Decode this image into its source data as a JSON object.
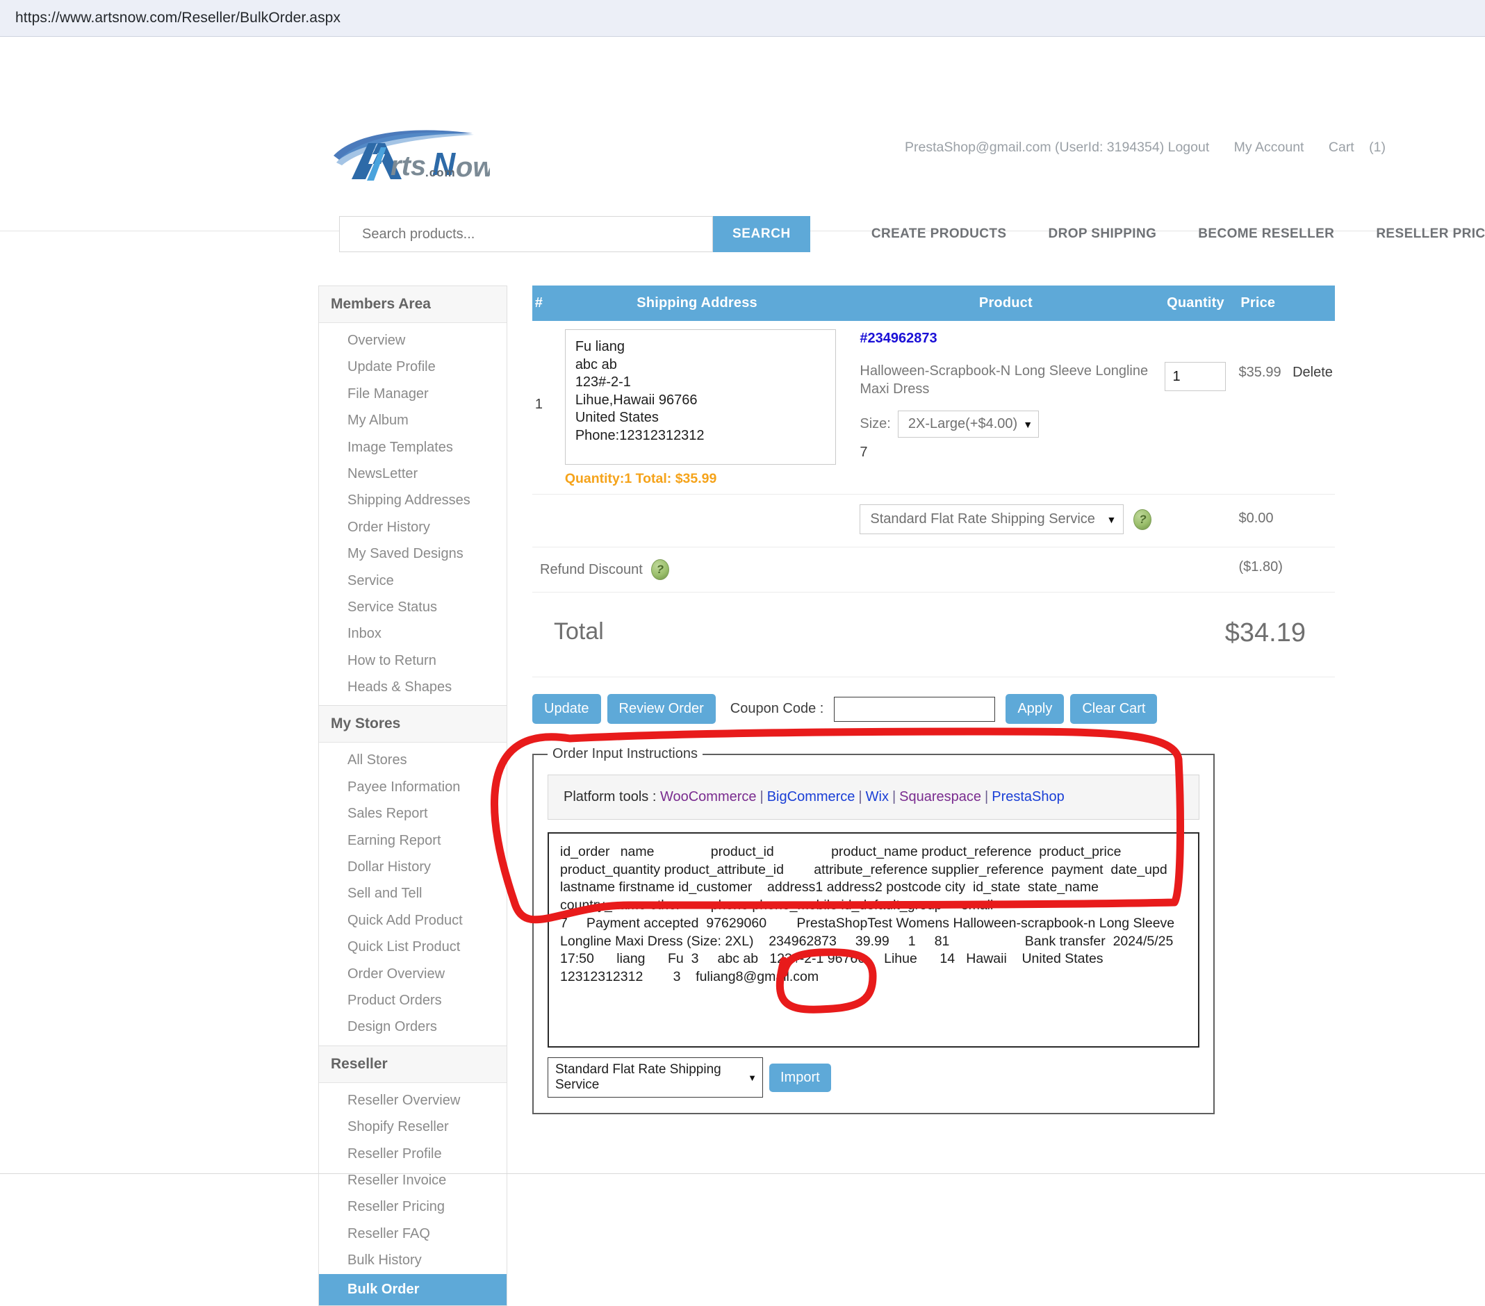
{
  "browser": {
    "url": "https://www.artsnow.com/Reseller/BulkOrder.aspx"
  },
  "header": {
    "logo_text": "ArtsNow",
    "logo_sub": ".com",
    "account_email": "PrestaShop@gmail.com (UserId: 3194354) Logout",
    "my_account": "My Account",
    "cart": "Cart",
    "cart_count": "(1)",
    "search_placeholder": "Search products...",
    "search_value": "",
    "search_button": "SEARCH",
    "nav": [
      {
        "label": "CREATE PRODUCTS"
      },
      {
        "label": "DROP SHIPPING"
      },
      {
        "label": "BECOME RESELLER"
      },
      {
        "label": "RESELLER PRICING"
      }
    ]
  },
  "sidebar": {
    "groups": [
      {
        "title": "Members Area",
        "items": [
          {
            "label": "Overview"
          },
          {
            "label": "Update Profile"
          },
          {
            "label": "File Manager"
          },
          {
            "label": "My Album"
          },
          {
            "label": "Image Templates"
          },
          {
            "label": "NewsLetter"
          },
          {
            "label": "Shipping Addresses"
          },
          {
            "label": "Order History"
          },
          {
            "label": "My Saved Designs"
          },
          {
            "label": "Service"
          },
          {
            "label": "Service Status"
          },
          {
            "label": "Inbox"
          },
          {
            "label": "How to Return"
          },
          {
            "label": "Heads & Shapes"
          }
        ]
      },
      {
        "title": "My Stores",
        "items": [
          {
            "label": "All Stores"
          },
          {
            "label": "Payee Information"
          },
          {
            "label": "Sales Report"
          },
          {
            "label": "Earning Report"
          },
          {
            "label": "Dollar History"
          },
          {
            "label": "Sell and Tell"
          },
          {
            "label": "Quick Add Product"
          },
          {
            "label": "Quick List Product"
          },
          {
            "label": "Order Overview"
          },
          {
            "label": "Product Orders"
          },
          {
            "label": "Design Orders"
          }
        ]
      },
      {
        "title": "Reseller",
        "items": [
          {
            "label": "Reseller Overview"
          },
          {
            "label": "Shopify Reseller"
          },
          {
            "label": "Reseller Profile"
          },
          {
            "label": "Reseller Invoice"
          },
          {
            "label": "Reseller Pricing"
          },
          {
            "label": "Reseller FAQ"
          },
          {
            "label": "Bulk History"
          },
          {
            "label": "Bulk Order",
            "active": true
          }
        ]
      }
    ]
  },
  "order_table": {
    "columns": {
      "num": "#",
      "shipping_address": "Shipping Address",
      "product": "Product",
      "quantity": "Quantity",
      "price": "Price"
    },
    "row": {
      "num": "1",
      "address_text": "Fu liang\nabc ab\n123#-2-1\nLihue,Hawaii 96766\nUnited States\nPhone:12312312312",
      "qty_total": "Quantity:1 Total: $35.99",
      "product_id": "#234962873",
      "product_name": "Halloween-Scrapbook-N Long Sleeve Longline Maxi Dress",
      "size_label": "Size:",
      "size_value": "2X-Large(+$4.00)",
      "attribute_num": "7",
      "quantity_value": "1",
      "price": "$35.99",
      "delete": "Delete"
    },
    "shipping_row": {
      "service": "Standard Flat Rate Shipping Service",
      "help_icon": "question-icon",
      "price": "$0.00"
    },
    "refund_row": {
      "label": "Refund Discount",
      "help_icon": "question-icon",
      "value": "($1.80)"
    },
    "total_row": {
      "label": "Total",
      "value": "$34.19"
    }
  },
  "actions": {
    "update": "Update",
    "review_order": "Review Order",
    "coupon_label": "Coupon Code :",
    "coupon_value": "",
    "apply": "Apply",
    "clear_cart": "Clear Cart"
  },
  "order_input": {
    "legend": "Order Input Instructions",
    "platform_label": "Platform tools :",
    "platforms": [
      {
        "label": "WooCommerce",
        "color": "#7a2c8f"
      },
      {
        "label": "BigCommerce",
        "color": "#1a3fd6"
      },
      {
        "label": "Wix",
        "color": "#1a3fd6"
      },
      {
        "label": "Squarespace",
        "color": "#7a2c8f"
      },
      {
        "label": "PrestaShop",
        "color": "#1a3fd6"
      }
    ],
    "separator": "|",
    "textarea_value": "id_order\tname\t\tproduct_id\t\tproduct_name product_reference  product_price  product_quantity product_attribute_id        attribute_reference supplier_reference  payment  date_upd lastname firstname id_customer    address1 address2 postcode city  id_state  state_name     country_name other        phone phone_mobile id_default_group     email\n7     Payment accepted  97629060        PrestaShopTest Womens Halloween-scrapbook-n Long Sleeve Longline Maxi Dress (Size: 2XL)    234962873     39.99     1     81                    Bank transfer  2024/5/25 17:50      liang      Fu  3     abc ab   123#-2-1 96766     Lihue      14   Hawaii    United States 12312312312        3    fuliang8@gmail.com",
    "import_service": "Standard Flat Rate Shipping Service",
    "import_button": "Import"
  },
  "colors": {
    "brand_blue": "#5ea9d8",
    "orange": "#f5a31a",
    "link_blue": "#1a0fd6",
    "annotation_red": "#e81b1b"
  }
}
